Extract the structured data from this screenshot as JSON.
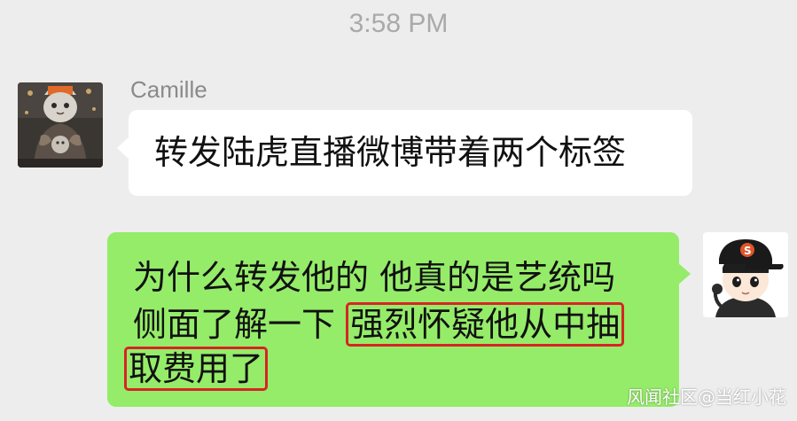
{
  "timestamp": "3:58 PM",
  "incoming": {
    "sender": "Camille",
    "avatar": "avatar-icon",
    "text": "转发陆虎直播微博带着两个标签",
    "bubble_color": "#ffffff"
  },
  "outgoing": {
    "avatar": "avatar-icon",
    "bubble_color": "#95ec69",
    "line1": "为什么转发他的 他真的是艺统吗",
    "line2_plain": "侧面了解一下 ",
    "line2_highlight": "强烈怀疑他从中抽",
    "line3_highlight": "取费用了",
    "highlight_color": "#d72424"
  },
  "watermark": "风闻社区@当红小花"
}
